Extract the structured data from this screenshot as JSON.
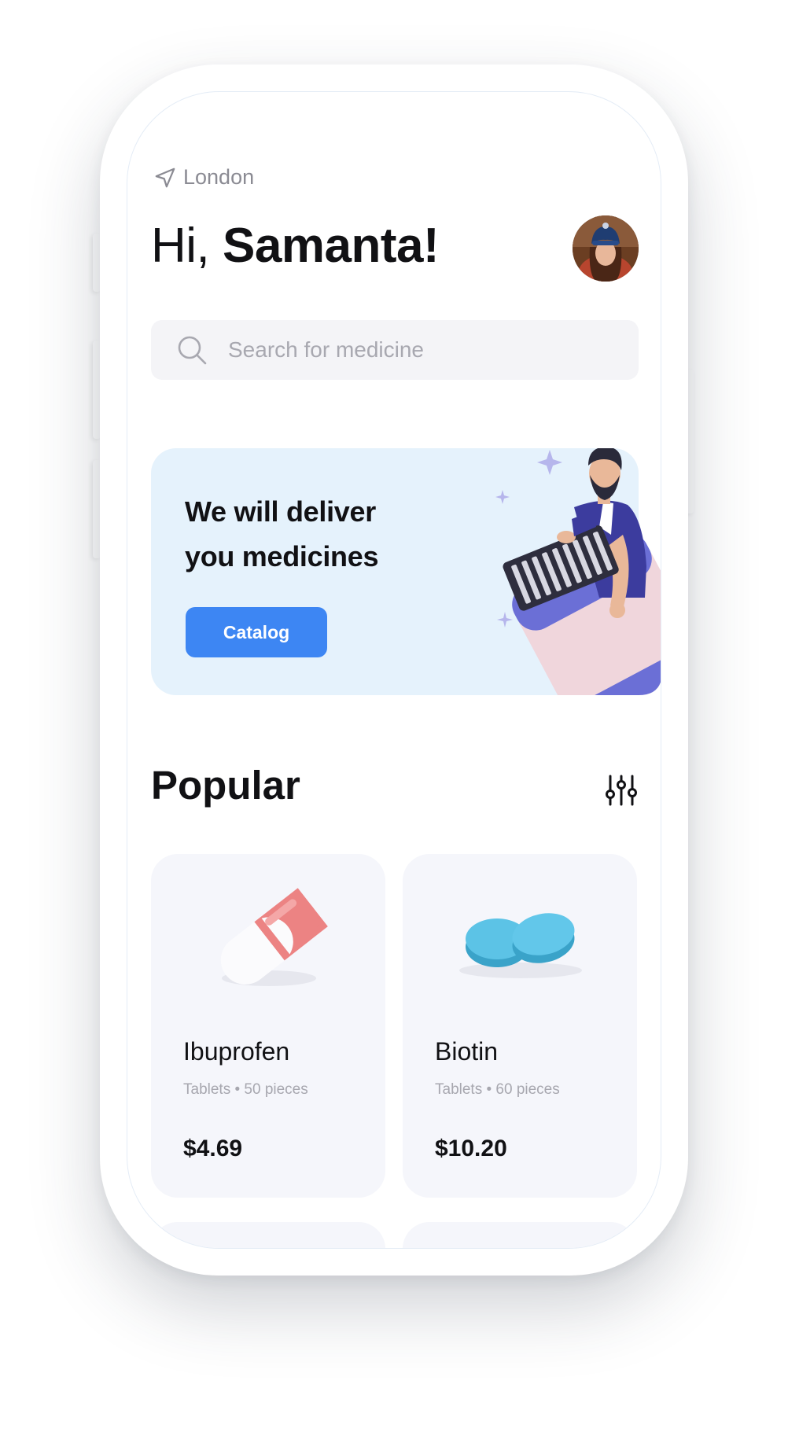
{
  "header": {
    "location": "London",
    "greeting_prefix": "Hi,",
    "greeting_name": "Samanta!"
  },
  "search": {
    "placeholder": "Search for medicine",
    "value": ""
  },
  "banner": {
    "title": "We will deliver you medicines",
    "button_label": "Catalog"
  },
  "popular": {
    "title": "Popular",
    "items": [
      {
        "name": "Ibuprofen",
        "details": "Tablets • 50 pieces",
        "price": "$4.69",
        "icon": "capsule-icon"
      },
      {
        "name": "Biotin",
        "details": "Tablets • 60 pieces",
        "price": "$10.20",
        "icon": "tablets-icon"
      }
    ]
  },
  "colors": {
    "accent": "#3d86f3",
    "banner_bg": "#e5f2fc",
    "card_bg": "#f5f6fb",
    "capsule_red": "#ec8383",
    "tablet_blue": "#56bde3"
  }
}
